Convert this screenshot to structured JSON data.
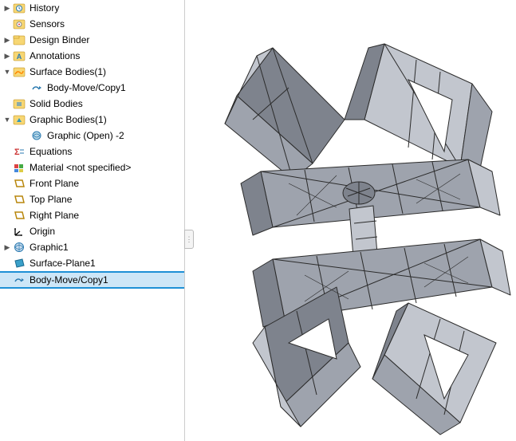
{
  "tree": [
    {
      "id": "history",
      "label": "History",
      "indent": 1,
      "arrow": "collapsed",
      "icon": "history-icon"
    },
    {
      "id": "sensors",
      "label": "Sensors",
      "indent": 1,
      "arrow": "none",
      "icon": "sensors-icon"
    },
    {
      "id": "designbinder",
      "label": "Design Binder",
      "indent": 1,
      "arrow": "collapsed",
      "icon": "folder-icon"
    },
    {
      "id": "annotations",
      "label": "Annotations",
      "indent": 1,
      "arrow": "collapsed",
      "icon": "annotations-icon"
    },
    {
      "id": "surfacebodies",
      "label": "Surface Bodies(1)",
      "indent": 1,
      "arrow": "expanded",
      "icon": "surface-folder-icon"
    },
    {
      "id": "bodymove1",
      "label": "Body-Move/Copy1",
      "indent": 2,
      "arrow": "none",
      "icon": "body-move-icon"
    },
    {
      "id": "solidbodies",
      "label": "Solid Bodies",
      "indent": 1,
      "arrow": "none",
      "icon": "solid-folder-icon"
    },
    {
      "id": "graphicbodies",
      "label": "Graphic Bodies(1)",
      "indent": 1,
      "arrow": "expanded",
      "icon": "graphic-folder-icon"
    },
    {
      "id": "graphicopen",
      "label": "Graphic (Open) -2",
      "indent": 2,
      "arrow": "none",
      "icon": "graphic-body-icon"
    },
    {
      "id": "equations",
      "label": "Equations",
      "indent": 1,
      "arrow": "none",
      "icon": "equations-icon"
    },
    {
      "id": "material",
      "label": "Material <not specified>",
      "indent": 1,
      "arrow": "none",
      "icon": "material-icon"
    },
    {
      "id": "frontplane",
      "label": "Front Plane",
      "indent": 1,
      "arrow": "none",
      "icon": "plane-icon"
    },
    {
      "id": "topplane",
      "label": "Top Plane",
      "indent": 1,
      "arrow": "none",
      "icon": "plane-icon"
    },
    {
      "id": "rightplane",
      "label": "Right Plane",
      "indent": 1,
      "arrow": "none",
      "icon": "plane-icon"
    },
    {
      "id": "origin",
      "label": "Origin",
      "indent": 1,
      "arrow": "none",
      "icon": "origin-icon"
    },
    {
      "id": "graphic1",
      "label": "Graphic1",
      "indent": 1,
      "arrow": "collapsed",
      "icon": "graphic-feature-icon"
    },
    {
      "id": "surfaceplane1",
      "label": "Surface-Plane1",
      "indent": 1,
      "arrow": "none",
      "icon": "surface-plane-icon"
    },
    {
      "id": "bodymove2",
      "label": "Body-Move/Copy1",
      "indent": 1,
      "arrow": "none",
      "icon": "body-move-icon",
      "selected": true
    }
  ],
  "colors": {
    "model_fill_dark": "#7a7f88",
    "model_fill_mid": "#9ea3ad",
    "model_fill_light": "#bfc3cc",
    "model_edge": "#2b2b2b"
  }
}
